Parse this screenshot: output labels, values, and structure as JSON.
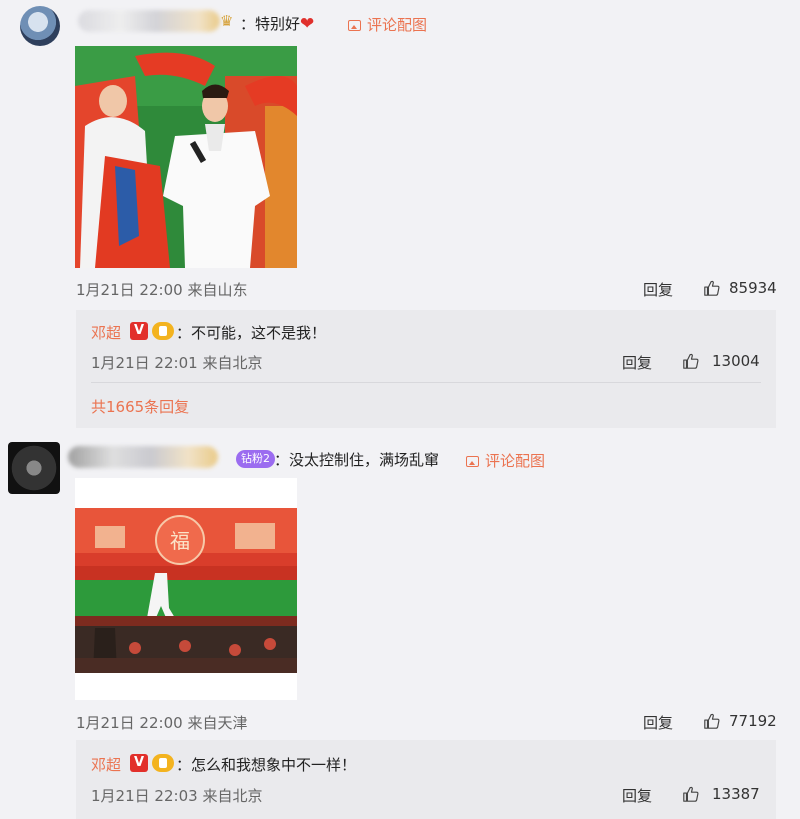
{
  "comments": [
    {
      "text": "：特别好",
      "heart": "❤",
      "pic_link": "评论配图",
      "date": "1月21日",
      "time": "22:00",
      "location": "来自山东",
      "reply_label": "回复",
      "likes": "85934",
      "subreply": {
        "name": "邓超",
        "text": "：不可能，这不是我！",
        "date": "1月21日",
        "time": "22:01",
        "location": "来自北京",
        "reply_label": "回复",
        "likes": "13004"
      },
      "more_replies": "共1665条回复"
    },
    {
      "fan_badge": "钻粉2",
      "text": "：没太控制住，满场乱窜",
      "pic_link": "评论配图",
      "date": "1月21日",
      "time": "22:00",
      "location": "来自天津",
      "reply_label": "回复",
      "likes": "77192",
      "subreply": {
        "name": "邓超",
        "text": "：怎么和我想象中不一样！",
        "date": "1月21日",
        "time": "22:03",
        "location": "来自北京",
        "reply_label": "回复",
        "likes": "13387"
      }
    }
  ],
  "colors": {
    "accent": "#eb7350",
    "background": "#f2f2f5",
    "subreply_bg": "#eaeaed",
    "verified_red": "#e2302b",
    "crown_gold": "#d6a23a"
  }
}
